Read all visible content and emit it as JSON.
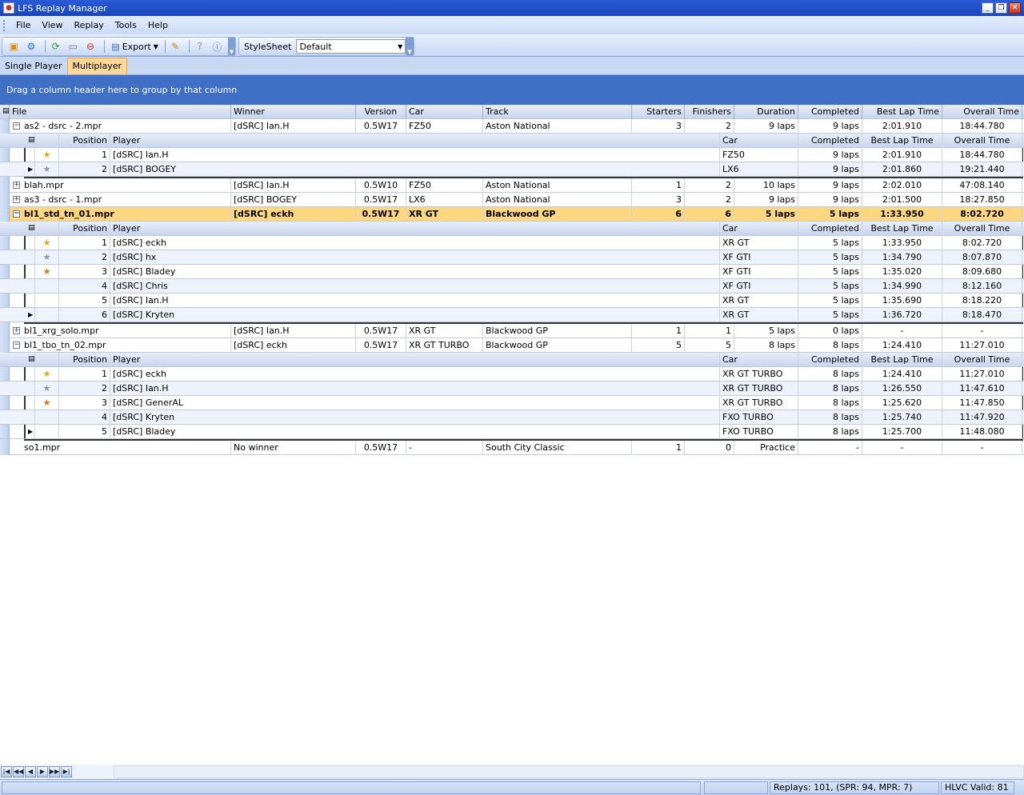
{
  "window": {
    "title": "LFS Replay Manager"
  },
  "menu": [
    "File",
    "View",
    "Replay",
    "Tools",
    "Help"
  ],
  "toolbar": {
    "export_label": "Export",
    "stylesheet_label": "StyleSheet",
    "stylesheet_value": "Default"
  },
  "tabs": [
    "Single Player",
    "Multiplayer"
  ],
  "group_panel_text": "Drag a column header here to group by that column",
  "columns": [
    "File",
    "Winner",
    "Version",
    "Car",
    "Track",
    "Starters",
    "Finishers",
    "Duration",
    "Completed",
    "Best Lap Time",
    "Overall Time"
  ],
  "child_columns": [
    "Position",
    "Player",
    "Car",
    "Completed",
    "Best Lap Time",
    "Overall Time"
  ],
  "replays": [
    {
      "file": "as2 - dsrc - 2.mpr",
      "winner": "[dSRC] Ian.H",
      "version": "0.5W17",
      "car": "FZ50",
      "track": "Aston National",
      "starters": "3",
      "finishers": "2",
      "duration": "9 laps",
      "completed": "9 laps",
      "best": "2:01.910",
      "overall": "18:44.780",
      "expanded": true,
      "players": [
        {
          "pos": "1",
          "player": "[dSRC] Ian.H",
          "car": "FZ50",
          "completed": "9 laps",
          "best": "2:01.910",
          "overall": "18:44.780",
          "medal": "gold"
        },
        {
          "pos": "2",
          "player": "[dSRC] BOGEY",
          "car": "LX6",
          "completed": "9 laps",
          "best": "2:01.860",
          "overall": "19:21.440",
          "medal": "silver"
        }
      ]
    },
    {
      "file": "blah.mpr",
      "winner": "[dSRC] Ian.H",
      "version": "0.5W10",
      "car": "FZ50",
      "track": "Aston National",
      "starters": "1",
      "finishers": "2",
      "duration": "10 laps",
      "completed": "9 laps",
      "best": "2:02.010",
      "overall": "47:08.140",
      "expanded": false
    },
    {
      "file": "as3 - dsrc - 1.mpr",
      "winner": "[dSRC] BOGEY",
      "version": "0.5W17",
      "car": "LX6",
      "track": "Aston National",
      "starters": "3",
      "finishers": "2",
      "duration": "9 laps",
      "completed": "9 laps",
      "best": "2:01.500",
      "overall": "18:27.850",
      "expanded": false
    },
    {
      "file": "bl1_std_tn_01.mpr",
      "winner": "[dSRC] eckh",
      "version": "0.5W17",
      "car": "XR GT",
      "track": "Blackwood GP",
      "starters": "6",
      "finishers": "6",
      "duration": "5 laps",
      "completed": "5 laps",
      "best": "1:33.950",
      "overall": "8:02.720",
      "expanded": true,
      "selected": true,
      "players": [
        {
          "pos": "1",
          "player": "[dSRC] eckh",
          "car": "XR GT",
          "completed": "5 laps",
          "best": "1:33.950",
          "overall": "8:02.720",
          "medal": "gold"
        },
        {
          "pos": "2",
          "player": "[dSRC] hx",
          "car": "XF GTI",
          "completed": "5 laps",
          "best": "1:34.790",
          "overall": "8:07.870",
          "medal": "silver"
        },
        {
          "pos": "3",
          "player": "[dSRC] Bladey",
          "car": "XF GTI",
          "completed": "5 laps",
          "best": "1:35.020",
          "overall": "8:09.680",
          "medal": "bronze"
        },
        {
          "pos": "4",
          "player": "[dSRC] Chris",
          "car": "XF GTI",
          "completed": "5 laps",
          "best": "1:34.990",
          "overall": "8:12.160",
          "medal": ""
        },
        {
          "pos": "5",
          "player": "[dSRC] Ian.H",
          "car": "XR GT",
          "completed": "5 laps",
          "best": "1:35.690",
          "overall": "8:18.220",
          "medal": ""
        },
        {
          "pos": "6",
          "player": "[dSRC] Kryten",
          "car": "XR GT",
          "completed": "5 laps",
          "best": "1:36.720",
          "overall": "8:18.470",
          "medal": ""
        }
      ]
    },
    {
      "file": "bl1_xrg_solo.mpr",
      "winner": "[dSRC] Ian.H",
      "version": "0.5W17",
      "car": "XR GT",
      "track": "Blackwood GP",
      "starters": "1",
      "finishers": "1",
      "duration": "5 laps",
      "completed": "0 laps",
      "best": "-",
      "overall": "-",
      "expanded": false
    },
    {
      "file": "bl1_tbo_tn_02.mpr",
      "winner": "[dSRC] eckh",
      "version": "0.5W17",
      "car": "XR GT TURBO",
      "track": "Blackwood GP",
      "starters": "5",
      "finishers": "5",
      "duration": "8 laps",
      "completed": "8 laps",
      "best": "1:24.410",
      "overall": "11:27.010",
      "expanded": true,
      "players": [
        {
          "pos": "1",
          "player": "[dSRC] eckh",
          "car": "XR GT TURBO",
          "completed": "8 laps",
          "best": "1:24.410",
          "overall": "11:27.010",
          "medal": "gold"
        },
        {
          "pos": "2",
          "player": "[dSRC] Ian.H",
          "car": "XR GT TURBO",
          "completed": "8 laps",
          "best": "1:26.550",
          "overall": "11:47.610",
          "medal": "silver"
        },
        {
          "pos": "3",
          "player": "[dSRC] GenerAL",
          "car": "XR GT TURBO",
          "completed": "8 laps",
          "best": "1:25.620",
          "overall": "11:47.850",
          "medal": "bronze"
        },
        {
          "pos": "4",
          "player": "[dSRC] Kryten",
          "car": "FXO TURBO",
          "completed": "8 laps",
          "best": "1:25.740",
          "overall": "11:47.920",
          "medal": ""
        },
        {
          "pos": "5",
          "player": "[dSRC] Bladey",
          "car": "FXO TURBO",
          "completed": "8 laps",
          "best": "1:25.700",
          "overall": "11:48.080",
          "medal": ""
        }
      ]
    },
    {
      "file": "so1.mpr",
      "winner": "No winner",
      "version": "0.5W17",
      "car": "-",
      "track": "South City Classic",
      "starters": "1",
      "finishers": "0",
      "duration": "Practice",
      "completed": "-",
      "best": "-",
      "overall": "-",
      "expanded": false,
      "noexpander": true
    }
  ],
  "status": {
    "replays": "Replays: 101, (SPR: 94, MPR: 7)",
    "hlvc": "HLVC Valid: 81"
  }
}
